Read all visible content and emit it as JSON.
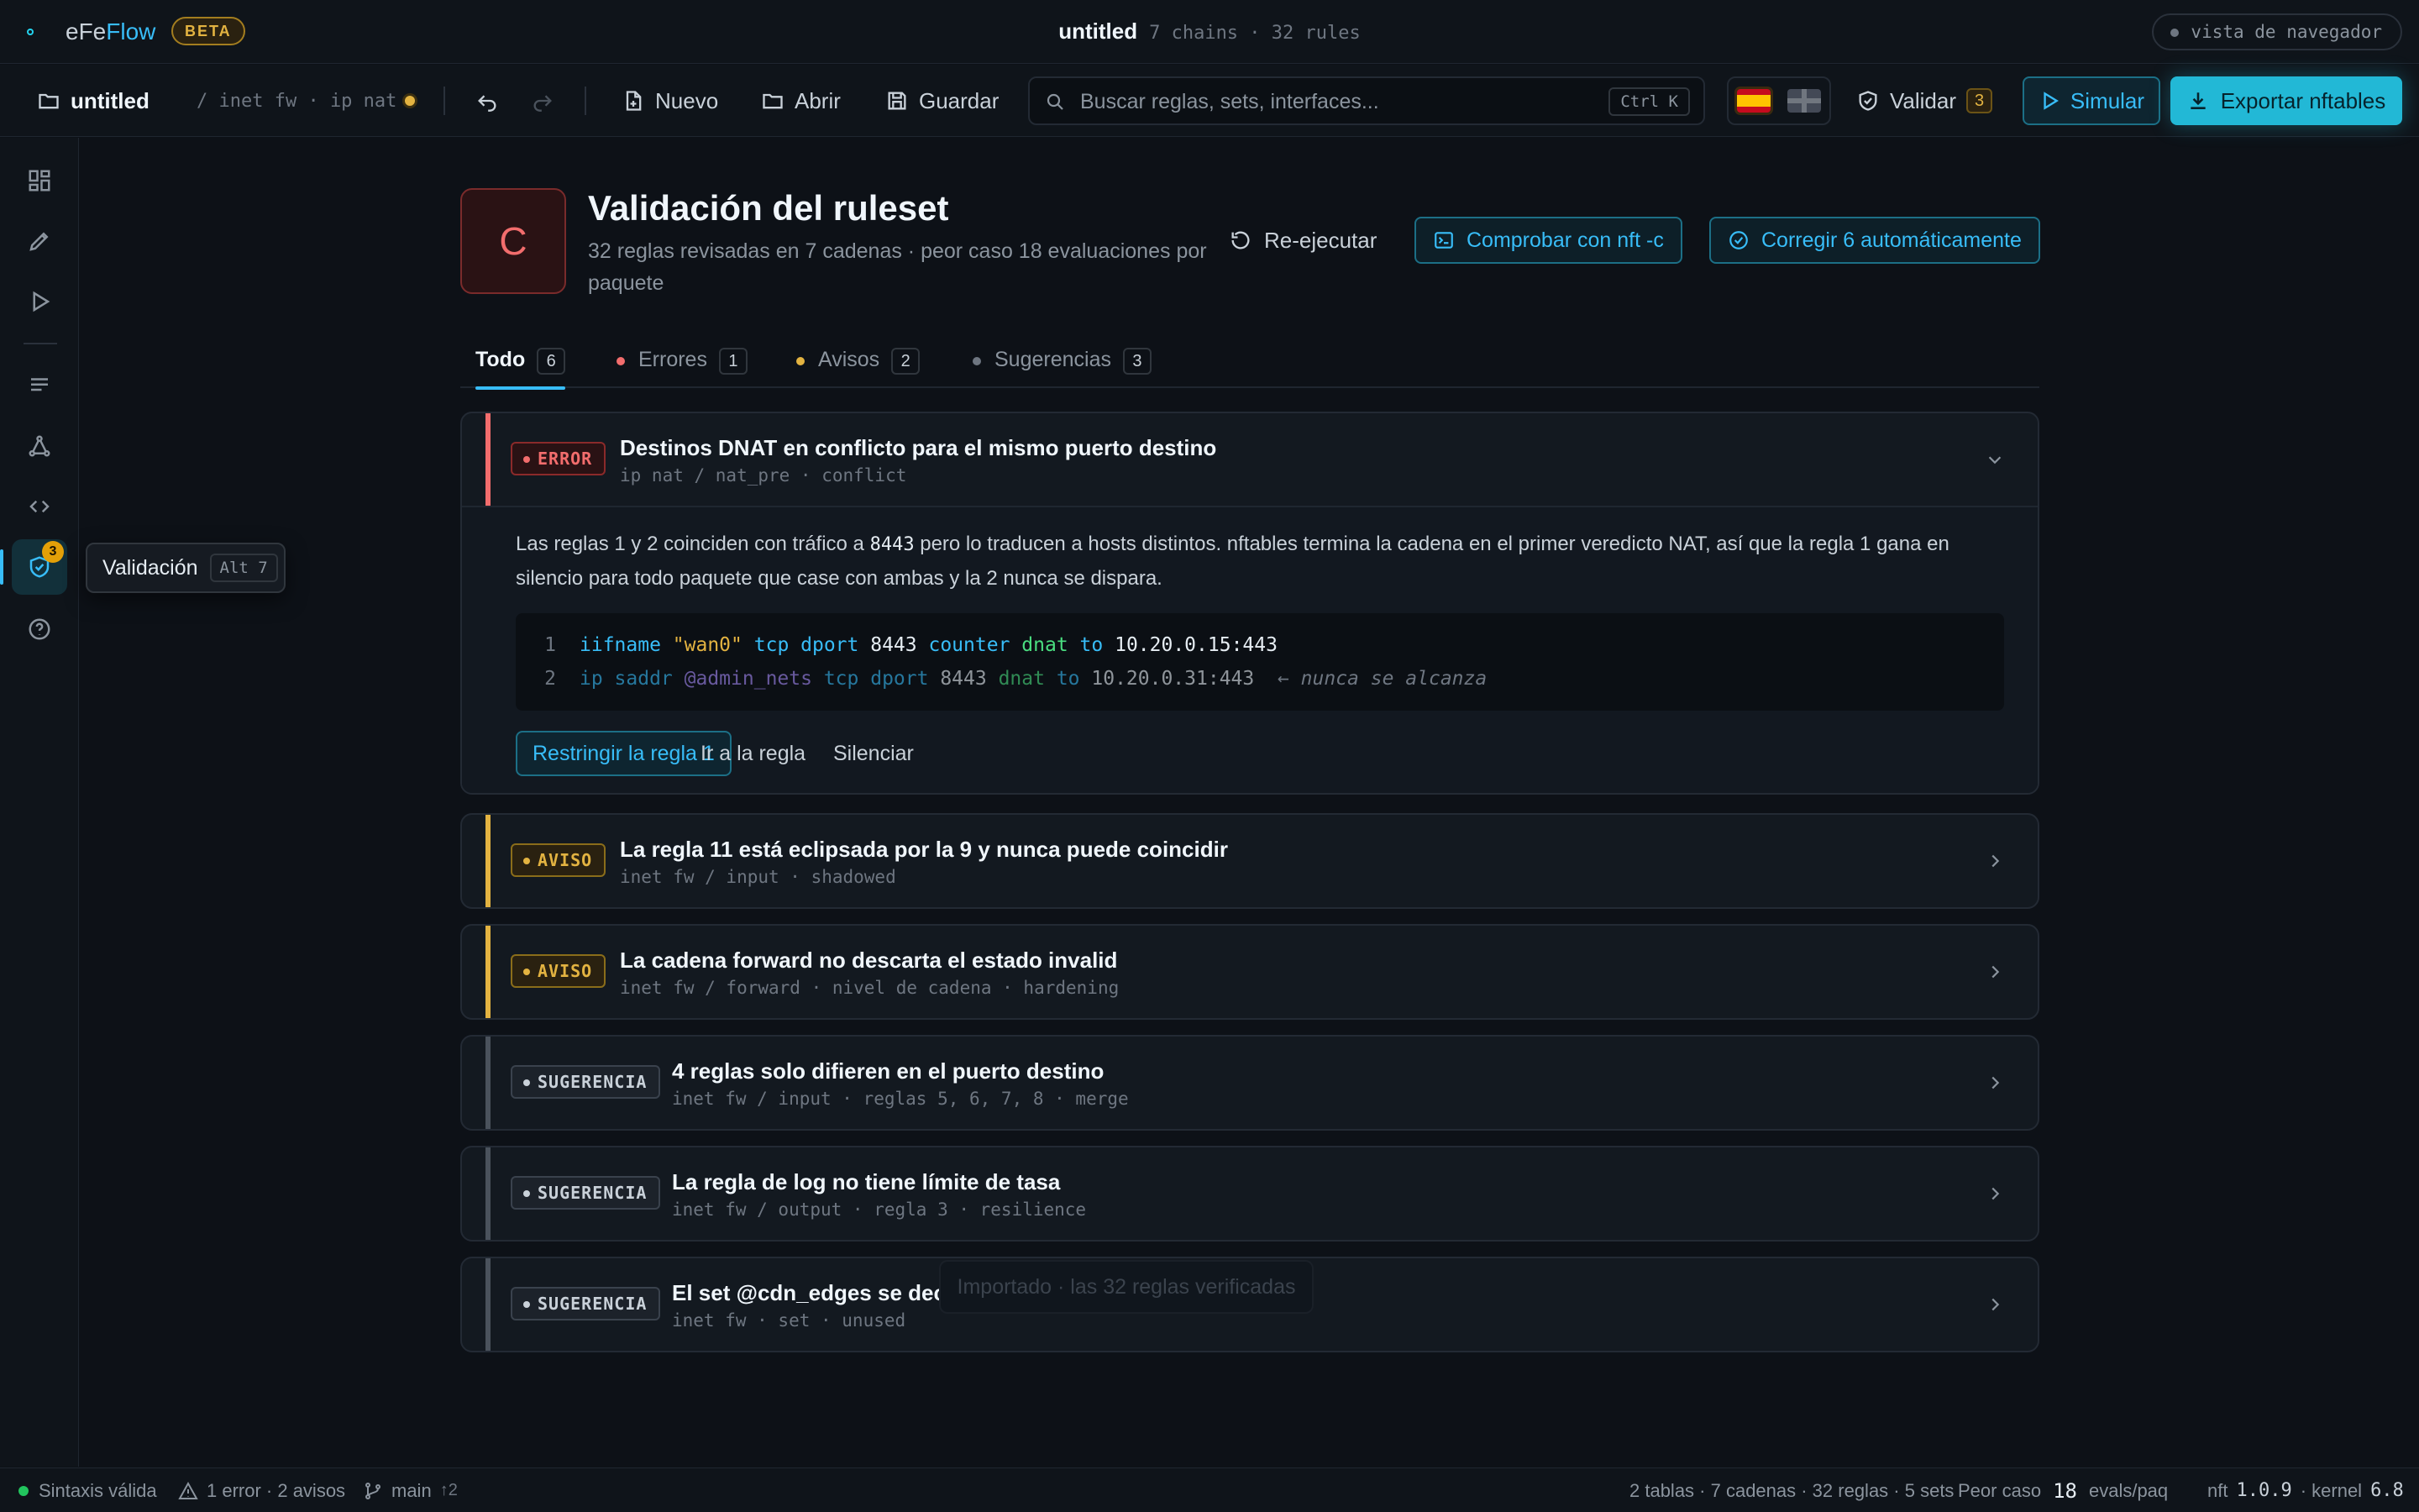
{
  "titlebar": {
    "logo_prefix": "eFe",
    "logo_suffix": "Flow",
    "beta": "BETA",
    "doc_title": "untitled",
    "doc_meta": "7 chains · 32 rules",
    "browser_mode": "vista de navegador"
  },
  "toolbar": {
    "filename": "untitled",
    "path": "/ inet fw · ip nat",
    "new": "Nuevo",
    "open": "Abrir",
    "save": "Guardar",
    "search_placeholder": "Buscar reglas, sets, interfaces...",
    "search_shortcut": "Ctrl K",
    "validate": "Validar",
    "validate_count": "3",
    "simulate": "Simular",
    "export": "Exportar nftables"
  },
  "sidebar": {
    "badge": "3",
    "tooltip_label": "Validación",
    "tooltip_shortcut": "Alt 7"
  },
  "header": {
    "grade": "C",
    "title": "Validación del ruleset",
    "subtitle": "32 reglas revisadas en 7 cadenas · peor caso 18 evaluaciones por paquete",
    "rerun": "Re-ejecutar",
    "check": "Comprobar con nft -c",
    "autofix": "Corregir 6 automáticamente"
  },
  "tabs": [
    {
      "label": "Todo",
      "count": "6"
    },
    {
      "label": "Errores",
      "count": "1"
    },
    {
      "label": "Avisos",
      "count": "2"
    },
    {
      "label": "Sugerencias",
      "count": "3"
    }
  ],
  "colors": {
    "error": "#f26d6d",
    "warning": "#e3b341",
    "suggestion": "#6e7681",
    "accent": "#38bdf8"
  },
  "issues": [
    {
      "level": "ERROR",
      "title": "Destinos DNAT en conflicto para el mismo puerto destino",
      "meta": "ip nat / nat_pre · conflict",
      "desc_a": "Las reglas 1 y 2 coinciden con tráfico a ",
      "desc_port": "8443",
      "desc_b": " pero lo traducen a hosts distintos. nftables termina la cadena en el primer veredicto NAT, así que la regla 1 gana en silencio para todo paquete que case con ambas y la 2 nunca se dispara.",
      "code": [
        {
          "n": "1",
          "iif": "iifname",
          "iifval": "\"wan0\"",
          "tcp": "tcp dport",
          "port": "8443",
          "counter": "counter",
          "dnat": "dnat",
          "to": "to",
          "addr": "10.20.0.15:443"
        },
        {
          "n": "2",
          "ip": "ip saddr",
          "set": "@admin_nets",
          "tcp": "tcp dport",
          "port": "8443",
          "dnat": "dnat",
          "to": "to",
          "addr": "10.20.0.31:443",
          "comment": "← nunca se alcanza"
        }
      ],
      "actions": [
        "Restringir la regla 1",
        "Ir a la regla",
        "Silenciar"
      ]
    },
    {
      "level": "AVISO",
      "title": "La regla 11 está eclipsada por la 9 y nunca puede coincidir",
      "meta": "inet fw / input · shadowed"
    },
    {
      "level": "AVISO",
      "title": "La cadena forward no descarta el estado invalid",
      "meta": "inet fw / forward · nivel de cadena · hardening"
    },
    {
      "level": "SUGERENCIA",
      "title": "4 reglas solo difieren en el puerto destino",
      "meta": "inet fw / input · reglas 5, 6, 7, 8 · merge"
    },
    {
      "level": "SUGERENCIA",
      "title": "La regla de log no tiene límite de tasa",
      "meta": "inet fw / output · regla 3 · resilience"
    },
    {
      "level": "SUGERENCIA",
      "title": "El set @cdn_edges se declara pero nunca se referencia",
      "meta": "inet fw · set · unused"
    }
  ],
  "toast": "Importado · las 32 reglas verificadas",
  "statusbar": {
    "syntax": "Sintaxis válida",
    "problems": "1 error · 2 avisos",
    "branch": "main",
    "ahead": "↑2",
    "summary": "2 tablas · 7 cadenas · 32 reglas · 5 sets",
    "worst_label": "Peor caso",
    "worst_value": "18",
    "worst_unit": "evals/paq",
    "nft_label": "nft",
    "nft_version": "1.0.9",
    "kernel_label": "· kernel",
    "kernel_version": "6.8"
  }
}
